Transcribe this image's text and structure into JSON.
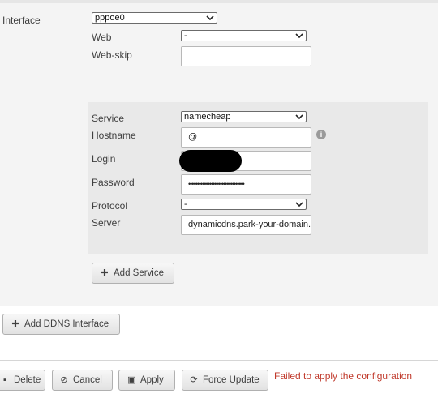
{
  "interface_section": {
    "interface_label": "Interface",
    "interface_value": "pppoe0",
    "web_label": "Web",
    "web_value": "-",
    "webskip_label": "Web-skip",
    "webskip_value": ""
  },
  "service_section": {
    "service_label": "Service",
    "service_value": "namecheap",
    "hostname_label": "Hostname",
    "hostname_value": "@",
    "login_label": "Login",
    "login_value": "",
    "password_label": "Password",
    "password_value": "••••••••••••••••••••••••••••••••",
    "protocol_label": "Protocol",
    "protocol_value": "-",
    "server_label": "Server",
    "server_value": "dynamicdns.park-your-domain.com"
  },
  "buttons": {
    "add_service": "Add Service",
    "add_ddns_interface": "Add DDNS Interface",
    "delete": "Delete",
    "cancel": "Cancel",
    "apply": "Apply",
    "force_update": "Force Update"
  },
  "status": {
    "error_message": "Failed to apply the configuration",
    "error_color": "#c0392b"
  },
  "icons": {
    "info": "info-icon",
    "plus": "plus-icon",
    "cancel": "cancel-icon",
    "apply": "save-icon",
    "force_update": "refresh-icon"
  }
}
